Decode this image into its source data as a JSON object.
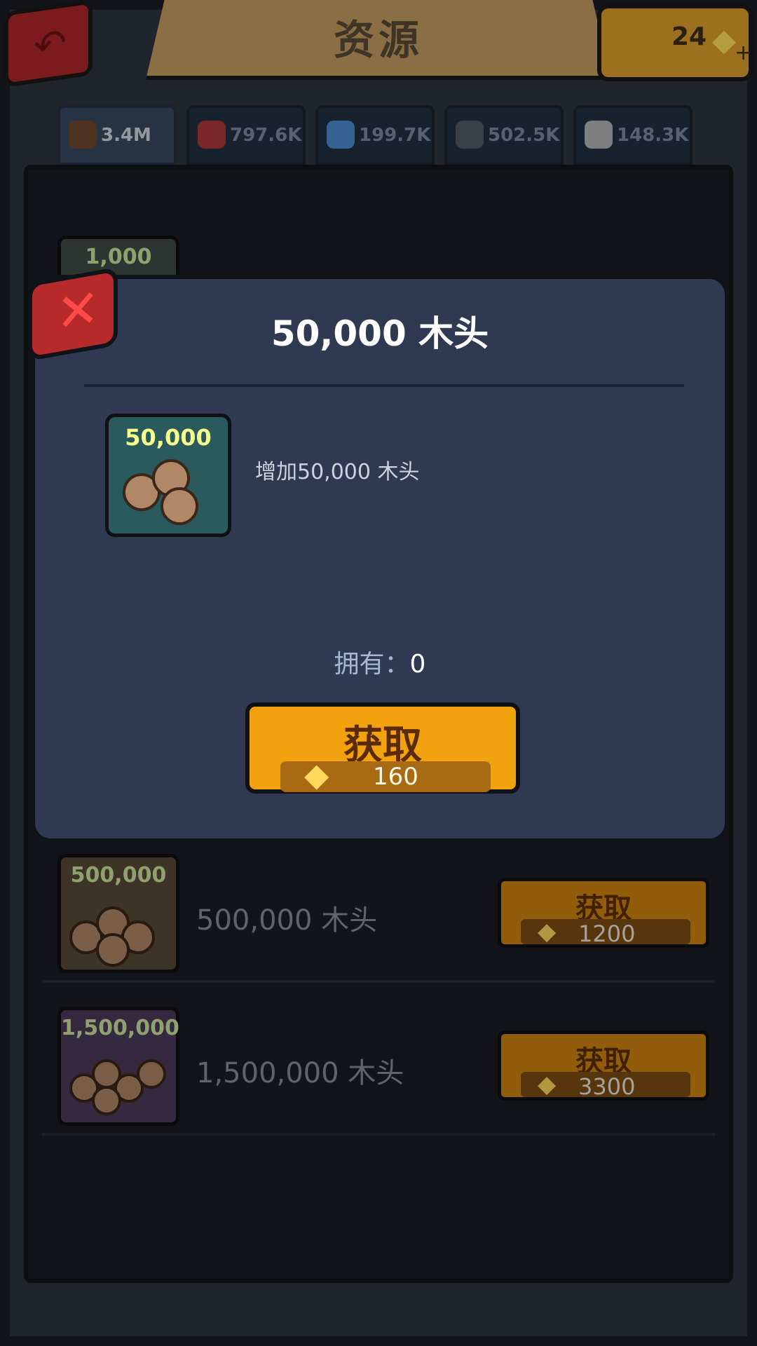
{
  "header": {
    "title": "资源"
  },
  "currency": {
    "gems": "24"
  },
  "tabs": [
    {
      "label": "3.4M",
      "icon": "wood-icon",
      "active": true
    },
    {
      "label": "797.6K",
      "icon": "meat-icon"
    },
    {
      "label": "199.7K",
      "icon": "water-icon"
    },
    {
      "label": "502.5K",
      "icon": "stone-icon"
    },
    {
      "label": "148.3K",
      "icon": "bone-icon"
    }
  ],
  "background_list": [
    {
      "card_label": "1,000"
    },
    {
      "card_label": "500,000",
      "name": "500,000 木头",
      "button": "获取",
      "cost": "1200"
    },
    {
      "card_label": "1,500,000",
      "name": "1,500,000 木头",
      "button": "获取",
      "cost": "3300"
    }
  ],
  "modal": {
    "title": "50,000 木头",
    "card_label": "50,000",
    "description": "增加50,000 木头",
    "owned_label": "拥有：",
    "owned_value": "0",
    "buy_label": "获取",
    "buy_cost": "160"
  }
}
